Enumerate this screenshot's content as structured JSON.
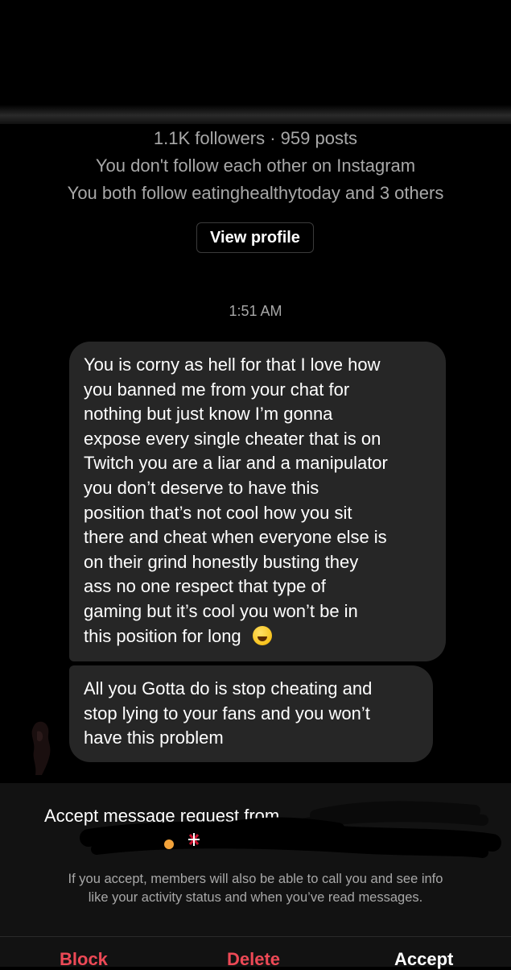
{
  "profile": {
    "stats": "1.1K followers · 959 posts",
    "follow_status": "You don't follow each other on Instagram",
    "mutuals": "You both follow eatinghealthytoday and 3 others",
    "view_profile_label": "View profile"
  },
  "thread": {
    "timestamp": "1:51 AM",
    "messages": [
      {
        "lines": [
          "You is corny as hell for that I love how",
          "you banned me from your chat for",
          "nothing but just know I’m gonna",
          "expose every single cheater that is on",
          "Twitch you are a liar and a manipulator",
          "you don’t deserve to have this",
          "position that’s not cool how you sit",
          "there and cheat when everyone else is",
          "on their grind honestly busting they",
          "ass no one respect that type of",
          "gaming but it’s cool you won’t be in",
          "this position for long"
        ],
        "emoji": "face-with-tears-of-joy-icon"
      },
      {
        "lines": [
          "All you Gotta do is stop cheating and",
          "stop lying to your fans and you won’t",
          "have this problem"
        ]
      }
    ]
  },
  "request": {
    "title_visible": "Accept message request from",
    "info_line_1": "If you accept, members will also be able to call you and see info",
    "info_line_2": "like your activity status and when you’ve read messages.",
    "block_label": "Block",
    "delete_label": "Delete",
    "accept_label": "Accept"
  },
  "colors": {
    "background": "#000000",
    "bubble": "#262626",
    "secondary_text": "#a8a8a8",
    "danger": "#ed4956",
    "panel": "#121212"
  }
}
